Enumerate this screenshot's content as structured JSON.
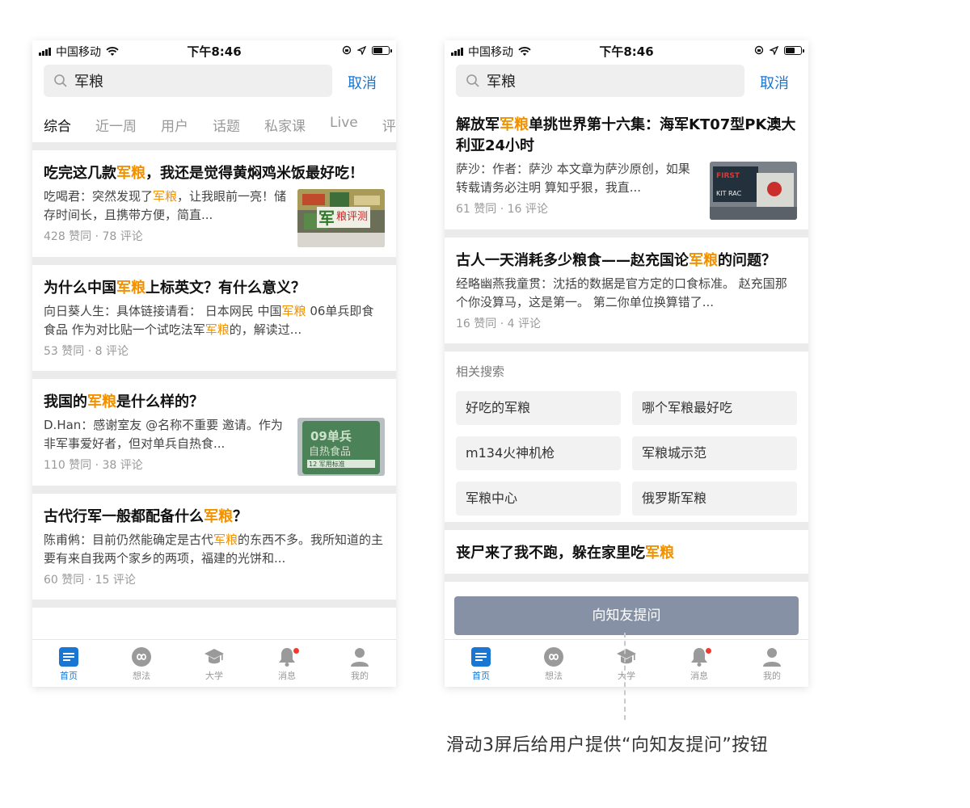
{
  "status_bar": {
    "carrier": "中国移动",
    "time": "下午8:46"
  },
  "search": {
    "query": "军粮",
    "cancel_label": "取消"
  },
  "tabs": [
    "综合",
    "近一周",
    "用户",
    "话题",
    "私家课",
    "Live",
    "评"
  ],
  "left_feed": [
    {
      "title_parts": [
        "吃完这几款",
        "军粮",
        "，我还是觉得黄焖鸡米饭最好吃！"
      ],
      "body_parts": [
        "吃喝君：突然发现了",
        "军粮",
        "，让我眼前一亮！储存时间长，且携带方便，简直..."
      ],
      "meta": "428 赞同 · 78 评论",
      "thumb": "军粮评测"
    },
    {
      "title_parts": [
        "为什么中国",
        "军粮",
        "上标英文？有什么意义？"
      ],
      "body_parts": [
        "向日葵人生：具体链接请看： 日本网民 中国",
        "军粮",
        " 06单兵即食食品 作为对比贴一个试吃法军",
        "军粮",
        "的，解读过..."
      ],
      "meta": "53 赞同 · 8 评论"
    },
    {
      "title_parts": [
        "我国的",
        "军粮",
        "是什么样的？"
      ],
      "body_parts": [
        "D.Han：感谢室友 @名称不重要 邀请。作为非军事爱好者，但对单兵自热食..."
      ],
      "meta": "110 赞同 · 38 评论",
      "thumb": "09单兵自热食品"
    },
    {
      "title_parts": [
        "古代行军一般都配备什么",
        "军粮",
        "？"
      ],
      "body_parts": [
        "陈甫鸺：目前仍然能确定是古代",
        "军粮",
        "的东西不多。我所知道的主要有来自我两个家乡的两项，福建的光饼和..."
      ],
      "meta": "60 赞同 · 15 评论"
    }
  ],
  "right_feed": [
    {
      "title_parts": [
        "解放军",
        "军粮",
        "单挑世界第十六集：海军KT07型PK澳大利亚24小时"
      ],
      "body_parts": [
        "萨沙：作者：萨沙 本文章为萨沙原创，如果转载请务必注明 算知乎狠，我直..."
      ],
      "meta": "61 赞同 · 16 评论",
      "thumb": "FIRST KIT RAC"
    },
    {
      "title_parts": [
        "古人一天消耗多少粮食——赵充国论",
        "军粮",
        "的问题？"
      ],
      "body_parts": [
        "经略幽燕我童贯：沈括的数据是官方定的口食标准。 赵充国那个你没算马，这是第一。 第二你单位换算错了..."
      ],
      "meta": "16 赞同 · 4 评论"
    }
  ],
  "related": {
    "title": "相关搜索",
    "items": [
      "好吃的军粮",
      "哪个军粮最好吃",
      "m134火神机枪",
      "军粮城示范",
      "军粮中心",
      "俄罗斯军粮"
    ]
  },
  "right_last_title_parts": [
    "丧尸来了我不跑，躲在家里吃",
    "军粮"
  ],
  "ask_button": "向知友提问",
  "tabbar": [
    {
      "label": "首页",
      "icon": "home-icon"
    },
    {
      "label": "想法",
      "icon": "ideas-icon"
    },
    {
      "label": "大学",
      "icon": "graduation-cap-icon"
    },
    {
      "label": "消息",
      "icon": "bell-icon"
    },
    {
      "label": "我的",
      "icon": "profile-icon"
    }
  ],
  "annotation": "滑动3屏后给用户提供“向知友提问”按钮",
  "colors": {
    "highlight": "#f29100",
    "accent": "#1976d2",
    "ask_button_bg": "#8791a5"
  }
}
